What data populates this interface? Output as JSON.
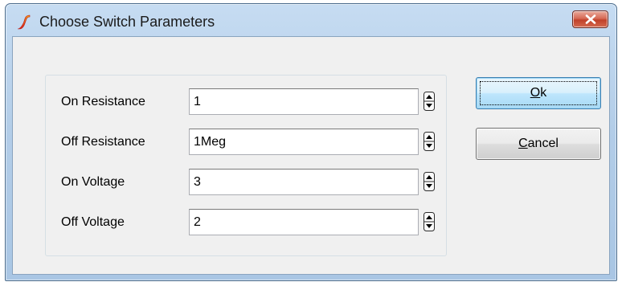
{
  "window": {
    "title": "Choose Switch Parameters",
    "icon": "simetrix-logo-icon",
    "close_glyph": "x"
  },
  "parameters": [
    {
      "label": "On Resistance",
      "value": "1"
    },
    {
      "label": "Off Resistance",
      "value": "1Meg"
    },
    {
      "label": "On Voltage",
      "value": "3"
    },
    {
      "label": "Off Voltage",
      "value": "2"
    }
  ],
  "buttons": {
    "ok": {
      "mnemonic": "O",
      "rest": "k"
    },
    "cancel": {
      "mnemonic": "C",
      "rest": "ancel"
    }
  },
  "colors": {
    "logo_red": "#d9201c",
    "logo_orange": "#f6a11b",
    "close_red": "#c0412a"
  }
}
